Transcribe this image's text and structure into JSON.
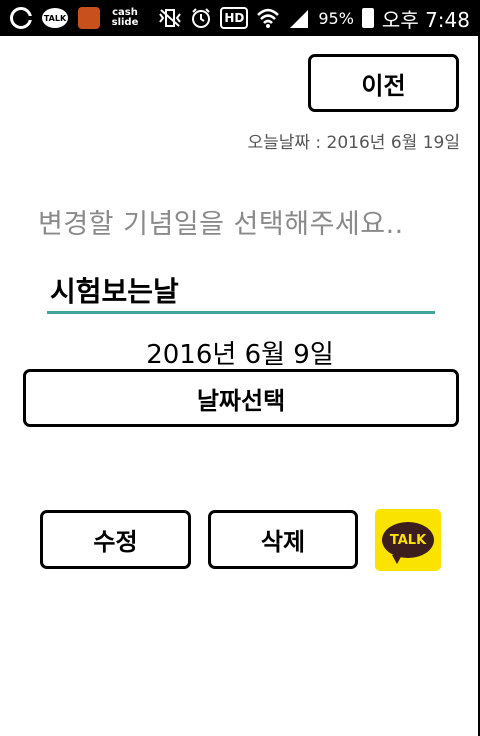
{
  "status_bar": {
    "icons": [
      "g-icon",
      "kakaotalk-icon",
      "burger-app-icon",
      "cashslide-icon",
      "vibrate-icon",
      "alarm-icon",
      "hd-icon",
      "wifi-icon",
      "signal-icon",
      "battery-icon"
    ],
    "cash_label_top": "cash",
    "cash_label_bottom": "slide",
    "talk_label": "TALK",
    "hd_label": "HD",
    "battery_percent": "95%",
    "time": "오후 7:48"
  },
  "header": {
    "prev_button_label": "이전",
    "today_text": "오늘날짜 : 2016년 6월 19일"
  },
  "form": {
    "prompt": "변경할 기념일을 선택해주세요..",
    "anniversary_name": "시험보는날",
    "selected_date": "2016년 6월 9일",
    "date_button_label": "날짜선택"
  },
  "actions": {
    "edit_label": "수정",
    "delete_label": "삭제",
    "kakao_label": "TALK"
  },
  "colors": {
    "input_underline": "#3fa79a",
    "kakao_yellow": "#fbe300",
    "kakao_brown": "#3c1e1e"
  }
}
